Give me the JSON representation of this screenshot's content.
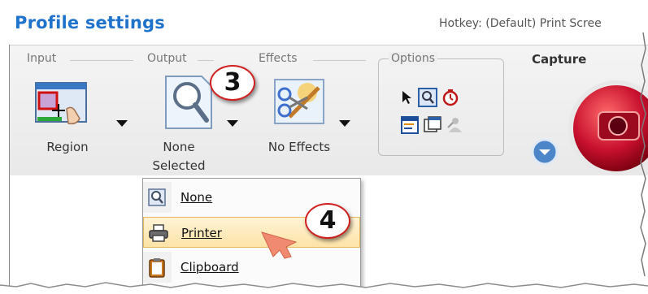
{
  "header": {
    "title": "Profile settings",
    "hotkey": "Hotkey: (Default) Print Scree"
  },
  "groups": {
    "input": "Input",
    "output": "Output",
    "effects": "Effects",
    "options": "Options",
    "capture": "Capture"
  },
  "tools": {
    "input_value": "Region",
    "output_value_line1": "None",
    "output_value_line2": "Selected",
    "effects_value": "No Effects"
  },
  "output_menu": {
    "items": [
      {
        "label": "None",
        "icon": "none-output-icon"
      },
      {
        "label": "Printer",
        "icon": "printer-icon"
      },
      {
        "label": "Clipboard",
        "icon": "clipboard-icon"
      }
    ],
    "selected": "Printer"
  },
  "callouts": {
    "step3": "3",
    "step4": "4"
  },
  "colors": {
    "title": "#1f73cc",
    "menu_highlight": "#fde3a7",
    "capture_button": "#c8102e",
    "badge_border": "#d02020"
  }
}
